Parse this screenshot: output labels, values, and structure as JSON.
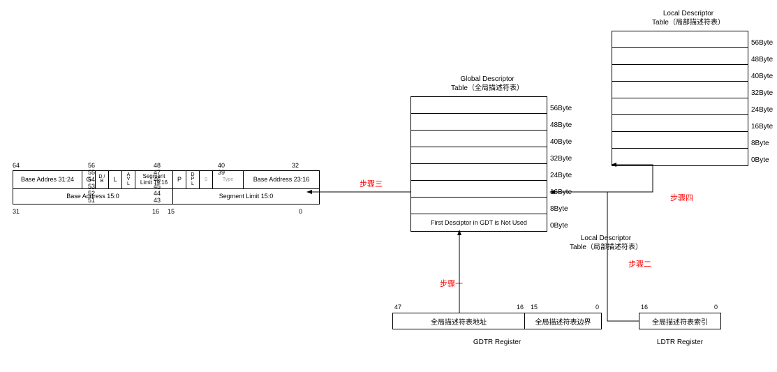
{
  "diagram": {
    "descriptor": {
      "top_ticks": [
        "64",
        "56 55 54 53 52 51",
        "48 47 46 45 44 43",
        "40 39",
        "32"
      ],
      "bottom_ticks": [
        "31",
        "16",
        "15",
        "0"
      ],
      "row1": {
        "base_31_24": "Base Addres 31:24",
        "g": "G",
        "db": "D / B",
        "l": "L",
        "avl": "A V L",
        "seg_limit_19_16": "Segment Limit 19:16",
        "p": "P",
        "dpl": "D P L",
        "s": "S",
        "type": "Type",
        "base_23_16": "Base Address 23:16"
      },
      "row2": {
        "base_15_0": "Base Address 15:0",
        "seg_limit_15_0": "Segment Limit 15:0"
      }
    },
    "gdt": {
      "title_line1": "Global Descriptor",
      "title_line2": "Table（全局描述符表）",
      "not_used": "First Desciptor in GDT is Not Used",
      "bytes": [
        "56Byte",
        "48Byte",
        "40Byte",
        "32Byte",
        "24Byte",
        "16Byte",
        "8Byte",
        "0Byte"
      ]
    },
    "ldt": {
      "title_line1": "Local Descriptor",
      "title_line2": "Table（局部描述符表）",
      "bytes": [
        "56Byte",
        "48Byte",
        "40Byte",
        "32Byte",
        "24Byte",
        "16Byte",
        "8Byte",
        "0Byte"
      ]
    },
    "ldt_label": {
      "title_line1": "Local Descriptor",
      "title_line2": "Table（局部描述符表）"
    },
    "gdtr": {
      "ticks": {
        "t47": "47",
        "t16": "16",
        "t15": "15",
        "t0": "0"
      },
      "addr": "全局描述符表地址",
      "limit": "全局描述符表边界",
      "label": "GDTR Register"
    },
    "ldtr": {
      "ticks": {
        "t16": "16",
        "t0": "0"
      },
      "index": "全局描述符表索引",
      "label": "LDTR Register"
    },
    "steps": {
      "s1": "步骤一",
      "s2": "步骤二",
      "s3": "步骤三",
      "s4": "步骤四"
    }
  }
}
